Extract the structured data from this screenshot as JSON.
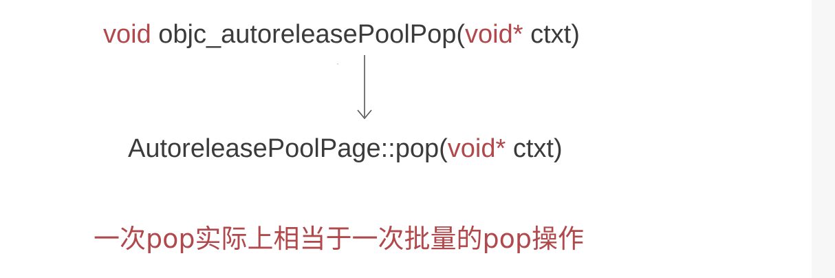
{
  "top_call": {
    "return_type": "void",
    "function_name": "objc_autoreleasePoolPop(",
    "param_type": "void*",
    "param_rest": " ctxt)"
  },
  "bottom_call": {
    "function_name": "AutoreleasePoolPage::pop(",
    "param_type": "void*",
    "param_rest": " ctxt)"
  },
  "note": "一次pop实际上相当于一次批量的pop操作",
  "colors": {
    "keyword": "#b0484c",
    "text": "#3b3b3b",
    "arrow": "#555555",
    "note": "#b0484c"
  },
  "icons": {
    "arrow": "arrow-down-icon"
  }
}
